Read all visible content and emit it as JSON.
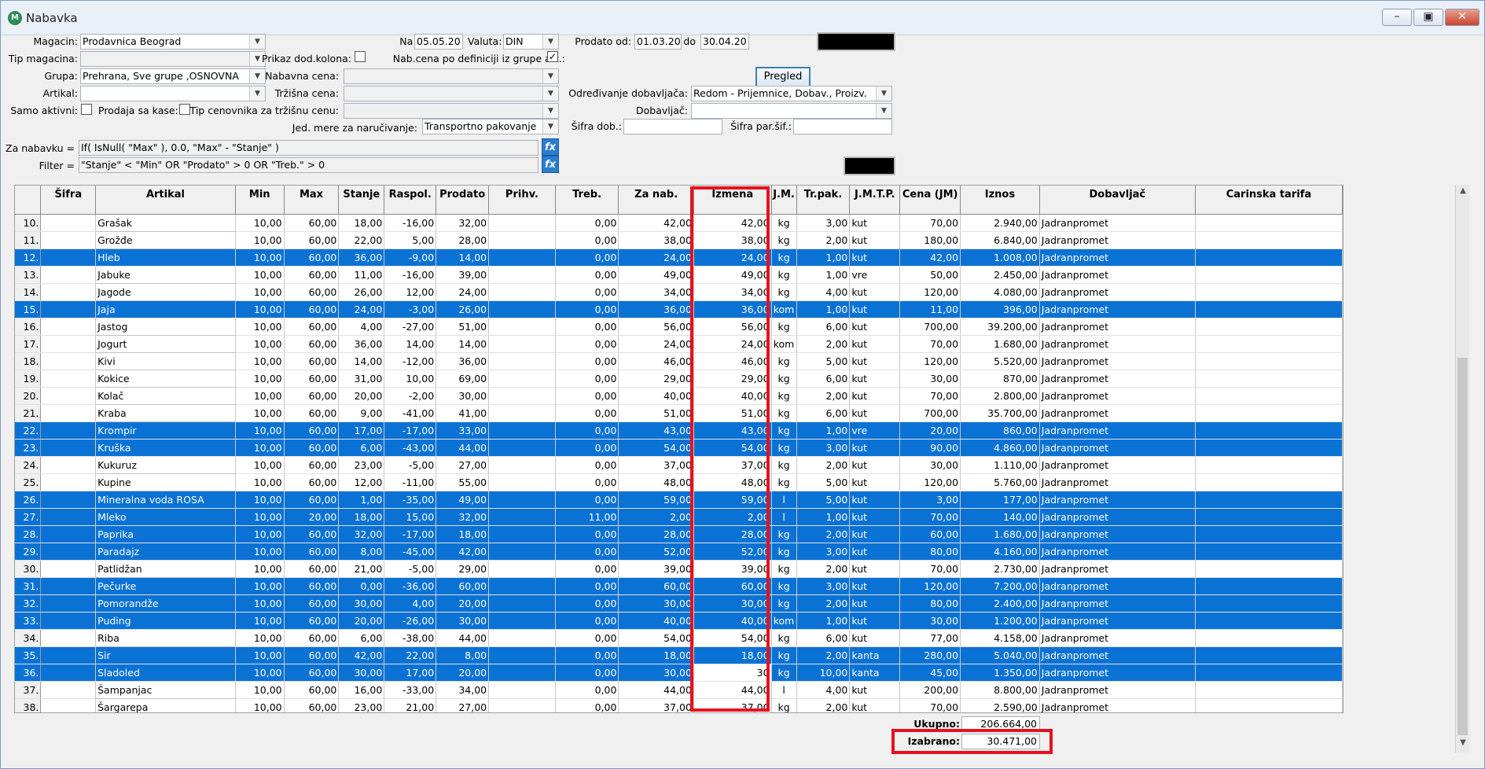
{
  "window": {
    "title": "Nabavka",
    "icon": "app-icon"
  },
  "form": {
    "magacin_label": "Magacin:",
    "magacin": "Prodavnica Beograd",
    "tip_magacina_label": "Tip magacina:",
    "tip_magacina": "",
    "grupa_label": "Grupa:",
    "grupa": "Prehrana, Sve grupe ,OSNOVNA",
    "artikal_label": "Artikal:",
    "artikal": "",
    "samo_aktivni_label": "Samo aktivni:",
    "prodaja_sa_kase_label": "Prodaja sa kase:",
    "prikaz_dod_kolona_label": "Prikaz dod.kolona:",
    "nabavna_cena_label": "Nabavna cena:",
    "trzisna_cena_label": "Tržišna cena:",
    "tip_cenovnika_label": "Tip cenovnika za tržišnu cenu:",
    "jed_mere_label": "Jed. mere za naručivanje:",
    "jed_mere": "Transportno pakovanje",
    "na_dan_label": "Na dan:",
    "na_dan": "05.05.20",
    "valuta_label": "Valuta:",
    "valuta": "DIN",
    "nab_cena_def_label": "Nab.cena po definiciji iz grupe art.:",
    "prodato_od_label": "Prodato od:",
    "prodato_od": "01.03.20",
    "do_label": "do",
    "prodato_do": "30.04.20",
    "pregled_label": "Pregled",
    "odredjivanje_label": "Određivanje dobavljača:",
    "odredjivanje": "Redom - Prijemnice, Dobav., Proizv.",
    "dobavljac_label": "Dobavljač:",
    "dobavljac": "",
    "sifra_dob_label": "Šifra dob.:",
    "sifra_par_label": "Šifra par.šif.:",
    "za_nabavku_label": "Za nabavku =",
    "za_nabavku": "If( IsNull( \"Max\" ), 0.0, \"Max\" - \"Stanje\" )",
    "filter_label": "Filter =",
    "filter": "\"Stanje\"  <  \"Min\" OR \"Prodato\" > 0 OR \"Treb.\" > 0",
    "fx_label": "fx"
  },
  "columns": [
    "",
    "Šifra",
    "Artikal",
    "Min",
    "Max",
    "Stanje",
    "Raspol.",
    "Prodato",
    "Prihv.",
    "Treb.",
    "Za nab.",
    "Izmena",
    "J.M.",
    "Tr.pak.",
    "J.M.T.P.",
    "Cena (JM)",
    "Iznos",
    "Dobavljač",
    "Carinska tarifa"
  ],
  "rows": [
    {
      "rn": "10.",
      "art": "Grašak",
      "min": "10,00",
      "max": "60,00",
      "st": "18,00",
      "ra": "-16,00",
      "pr": "32,00",
      "tr": "0,00",
      "zn": "42,00",
      "iz": "42,00",
      "jm": "kg",
      "tp": "3,00",
      "jmtp": "kut",
      "ce": "70,00",
      "izn": "2.940,00",
      "dob": "Jadranpromet",
      "sel": false
    },
    {
      "rn": "11.",
      "art": "Grožđe",
      "min": "10,00",
      "max": "60,00",
      "st": "22,00",
      "ra": "5,00",
      "pr": "28,00",
      "tr": "0,00",
      "zn": "38,00",
      "iz": "38,00",
      "jm": "kg",
      "tp": "2,00",
      "jmtp": "kut",
      "ce": "180,00",
      "izn": "6.840,00",
      "dob": "Jadranpromet",
      "sel": false
    },
    {
      "rn": "12.",
      "art": "Hleb",
      "min": "10,00",
      "max": "60,00",
      "st": "36,00",
      "ra": "-9,00",
      "pr": "14,00",
      "tr": "0,00",
      "zn": "24,00",
      "iz": "24,00",
      "jm": "kg",
      "tp": "1,00",
      "jmtp": "kut",
      "ce": "42,00",
      "izn": "1.008,00",
      "dob": "Jadranpromet",
      "sel": true
    },
    {
      "rn": "13.",
      "art": "Jabuke",
      "min": "10,00",
      "max": "60,00",
      "st": "11,00",
      "ra": "-16,00",
      "pr": "39,00",
      "tr": "0,00",
      "zn": "49,00",
      "iz": "49,00",
      "jm": "kg",
      "tp": "1,00",
      "jmtp": "vre",
      "ce": "50,00",
      "izn": "2.450,00",
      "dob": "Jadranpromet",
      "sel": false
    },
    {
      "rn": "14.",
      "art": "Jagode",
      "min": "10,00",
      "max": "60,00",
      "st": "26,00",
      "ra": "12,00",
      "pr": "24,00",
      "tr": "0,00",
      "zn": "34,00",
      "iz": "34,00",
      "jm": "kg",
      "tp": "4,00",
      "jmtp": "kut",
      "ce": "120,00",
      "izn": "4.080,00",
      "dob": "Jadranpromet",
      "sel": false
    },
    {
      "rn": "15.",
      "art": "Jaja",
      "min": "10,00",
      "max": "60,00",
      "st": "24,00",
      "ra": "-3,00",
      "pr": "26,00",
      "tr": "0,00",
      "zn": "36,00",
      "iz": "36,00",
      "jm": "kom",
      "tp": "1,00",
      "jmtp": "kut",
      "ce": "11,00",
      "izn": "396,00",
      "dob": "Jadranpromet",
      "sel": true
    },
    {
      "rn": "16.",
      "art": "Jastog",
      "min": "10,00",
      "max": "60,00",
      "st": "4,00",
      "ra": "-27,00",
      "pr": "51,00",
      "tr": "0,00",
      "zn": "56,00",
      "iz": "56,00",
      "jm": "kg",
      "tp": "6,00",
      "jmtp": "kut",
      "ce": "700,00",
      "izn": "39.200,00",
      "dob": "Jadranpromet",
      "sel": false
    },
    {
      "rn": "17.",
      "art": "Jogurt",
      "min": "10,00",
      "max": "60,00",
      "st": "36,00",
      "ra": "14,00",
      "pr": "14,00",
      "tr": "0,00",
      "zn": "24,00",
      "iz": "24,00",
      "jm": "kom",
      "tp": "2,00",
      "jmtp": "kut",
      "ce": "70,00",
      "izn": "1.680,00",
      "dob": "Jadranpromet",
      "sel": false
    },
    {
      "rn": "18.",
      "art": "Kivi",
      "min": "10,00",
      "max": "60,00",
      "st": "14,00",
      "ra": "-12,00",
      "pr": "36,00",
      "tr": "0,00",
      "zn": "46,00",
      "iz": "46,00",
      "jm": "kg",
      "tp": "5,00",
      "jmtp": "kut",
      "ce": "120,00",
      "izn": "5.520,00",
      "dob": "Jadranpromet",
      "sel": false
    },
    {
      "rn": "19.",
      "art": "Kokice",
      "min": "10,00",
      "max": "60,00",
      "st": "31,00",
      "ra": "10,00",
      "pr": "69,00",
      "tr": "0,00",
      "zn": "29,00",
      "iz": "29,00",
      "jm": "kg",
      "tp": "6,00",
      "jmtp": "kut",
      "ce": "30,00",
      "izn": "870,00",
      "dob": "Jadranpromet",
      "sel": false
    },
    {
      "rn": "20.",
      "art": "Kolač",
      "min": "10,00",
      "max": "60,00",
      "st": "20,00",
      "ra": "-2,00",
      "pr": "30,00",
      "tr": "0,00",
      "zn": "40,00",
      "iz": "40,00",
      "jm": "kg",
      "tp": "2,00",
      "jmtp": "kut",
      "ce": "70,00",
      "izn": "2.800,00",
      "dob": "Jadranpromet",
      "sel": false
    },
    {
      "rn": "21.",
      "art": "Kraba",
      "min": "10,00",
      "max": "60,00",
      "st": "9,00",
      "ra": "-41,00",
      "pr": "41,00",
      "tr": "0,00",
      "zn": "51,00",
      "iz": "51,00",
      "jm": "kg",
      "tp": "6,00",
      "jmtp": "kut",
      "ce": "700,00",
      "izn": "35.700,00",
      "dob": "Jadranpromet",
      "sel": false
    },
    {
      "rn": "22.",
      "art": "Krompir",
      "min": "10,00",
      "max": "60,00",
      "st": "17,00",
      "ra": "-17,00",
      "pr": "33,00",
      "tr": "0,00",
      "zn": "43,00",
      "iz": "43,00",
      "jm": "kg",
      "tp": "1,00",
      "jmtp": "vre",
      "ce": "20,00",
      "izn": "860,00",
      "dob": "Jadranpromet",
      "sel": true
    },
    {
      "rn": "23.",
      "art": "Kruška",
      "min": "10,00",
      "max": "60,00",
      "st": "6,00",
      "ra": "-43,00",
      "pr": "44,00",
      "tr": "0,00",
      "zn": "54,00",
      "iz": "54,00",
      "jm": "kg",
      "tp": "3,00",
      "jmtp": "kut",
      "ce": "90,00",
      "izn": "4.860,00",
      "dob": "Jadranpromet",
      "sel": true
    },
    {
      "rn": "24.",
      "art": "Kukuruz",
      "min": "10,00",
      "max": "60,00",
      "st": "23,00",
      "ra": "-5,00",
      "pr": "27,00",
      "tr": "0,00",
      "zn": "37,00",
      "iz": "37,00",
      "jm": "kg",
      "tp": "2,00",
      "jmtp": "kut",
      "ce": "30,00",
      "izn": "1.110,00",
      "dob": "Jadranpromet",
      "sel": false
    },
    {
      "rn": "25.",
      "art": "Kupine",
      "min": "10,00",
      "max": "60,00",
      "st": "12,00",
      "ra": "-11,00",
      "pr": "55,00",
      "tr": "0,00",
      "zn": "48,00",
      "iz": "48,00",
      "jm": "kg",
      "tp": "5,00",
      "jmtp": "kut",
      "ce": "120,00",
      "izn": "5.760,00",
      "dob": "Jadranpromet",
      "sel": false
    },
    {
      "rn": "26.",
      "art": "Mineralna voda ROSA",
      "min": "10,00",
      "max": "60,00",
      "st": "1,00",
      "ra": "-35,00",
      "pr": "49,00",
      "tr": "0,00",
      "zn": "59,00",
      "iz": "59,00",
      "jm": "l",
      "tp": "5,00",
      "jmtp": "kut",
      "ce": "3,00",
      "izn": "177,00",
      "dob": "Jadranpromet",
      "sel": true
    },
    {
      "rn": "27.",
      "art": "Mleko",
      "min": "10,00",
      "max": "20,00",
      "st": "18,00",
      "ra": "15,00",
      "pr": "32,00",
      "tr": "11,00",
      "zn": "2,00",
      "iz": "2,00",
      "jm": "l",
      "tp": "1,00",
      "jmtp": "kut",
      "ce": "70,00",
      "izn": "140,00",
      "dob": "Jadranpromet",
      "sel": true
    },
    {
      "rn": "28.",
      "art": "Paprika",
      "min": "10,00",
      "max": "60,00",
      "st": "32,00",
      "ra": "-17,00",
      "pr": "18,00",
      "tr": "0,00",
      "zn": "28,00",
      "iz": "28,00",
      "jm": "kg",
      "tp": "2,00",
      "jmtp": "kut",
      "ce": "60,00",
      "izn": "1.680,00",
      "dob": "Jadranpromet",
      "sel": true
    },
    {
      "rn": "29.",
      "art": "Paradajz",
      "min": "10,00",
      "max": "60,00",
      "st": "8,00",
      "ra": "-45,00",
      "pr": "42,00",
      "tr": "0,00",
      "zn": "52,00",
      "iz": "52,00",
      "jm": "kg",
      "tp": "3,00",
      "jmtp": "kut",
      "ce": "80,00",
      "izn": "4.160,00",
      "dob": "Jadranpromet",
      "sel": true
    },
    {
      "rn": "30.",
      "art": "Patlidžan",
      "min": "10,00",
      "max": "60,00",
      "st": "21,00",
      "ra": "-5,00",
      "pr": "29,00",
      "tr": "0,00",
      "zn": "39,00",
      "iz": "39,00",
      "jm": "kg",
      "tp": "2,00",
      "jmtp": "kut",
      "ce": "70,00",
      "izn": "2.730,00",
      "dob": "Jadranpromet",
      "sel": false
    },
    {
      "rn": "31.",
      "art": "Pečurke",
      "min": "10,00",
      "max": "60,00",
      "st": "0,00",
      "ra": "-36,00",
      "pr": "60,00",
      "tr": "0,00",
      "zn": "60,00",
      "iz": "60,00",
      "jm": "kg",
      "tp": "3,00",
      "jmtp": "kut",
      "ce": "120,00",
      "izn": "7.200,00",
      "dob": "Jadranpromet",
      "sel": true
    },
    {
      "rn": "32.",
      "art": "Pomorandže",
      "min": "10,00",
      "max": "60,00",
      "st": "30,00",
      "ra": "4,00",
      "pr": "20,00",
      "tr": "0,00",
      "zn": "30,00",
      "iz": "30,00",
      "jm": "kg",
      "tp": "2,00",
      "jmtp": "kut",
      "ce": "80,00",
      "izn": "2.400,00",
      "dob": "Jadranpromet",
      "sel": true
    },
    {
      "rn": "33.",
      "art": "Puding",
      "min": "10,00",
      "max": "60,00",
      "st": "20,00",
      "ra": "-26,00",
      "pr": "30,00",
      "tr": "0,00",
      "zn": "40,00",
      "iz": "40,00",
      "jm": "kom",
      "tp": "1,00",
      "jmtp": "kut",
      "ce": "30,00",
      "izn": "1.200,00",
      "dob": "Jadranpromet",
      "sel": true
    },
    {
      "rn": "34.",
      "art": "Riba",
      "min": "10,00",
      "max": "60,00",
      "st": "6,00",
      "ra": "-38,00",
      "pr": "44,00",
      "tr": "0,00",
      "zn": "54,00",
      "iz": "54,00",
      "jm": "kg",
      "tp": "6,00",
      "jmtp": "kut",
      "ce": "77,00",
      "izn": "4.158,00",
      "dob": "Jadranpromet",
      "sel": false
    },
    {
      "rn": "35.",
      "art": "Sir",
      "min": "10,00",
      "max": "60,00",
      "st": "42,00",
      "ra": "22,00",
      "pr": "8,00",
      "tr": "0,00",
      "zn": "18,00",
      "iz": "18,00",
      "jm": "kg",
      "tp": "2,00",
      "jmtp": "kanta",
      "ce": "280,00",
      "izn": "5.040,00",
      "dob": "Jadranpromet",
      "sel": true
    },
    {
      "rn": "36.",
      "art": "Sladoled",
      "min": "10,00",
      "max": "60,00",
      "st": "30,00",
      "ra": "17,00",
      "pr": "20,00",
      "tr": "0,00",
      "zn": "30,00",
      "iz": "30",
      "jm": "kg",
      "tp": "10,00",
      "jmtp": "kanta",
      "ce": "45,00",
      "izn": "1.350,00",
      "dob": "Jadranpromet",
      "sel": true,
      "editing": true
    },
    {
      "rn": "37.",
      "art": "Šampanjac",
      "min": "10,00",
      "max": "60,00",
      "st": "16,00",
      "ra": "-33,00",
      "pr": "34,00",
      "tr": "0,00",
      "zn": "44,00",
      "iz": "44,00",
      "jm": "l",
      "tp": "4,00",
      "jmtp": "kut",
      "ce": "200,00",
      "izn": "8.800,00",
      "dob": "Jadranpromet",
      "sel": false
    },
    {
      "rn": "38.",
      "art": "Šargarepa",
      "min": "10,00",
      "max": "60,00",
      "st": "23,00",
      "ra": "21,00",
      "pr": "27,00",
      "tr": "0,00",
      "zn": "37,00",
      "iz": "37,00",
      "jm": "kg",
      "tp": "2,00",
      "jmtp": "kut",
      "ce": "70,00",
      "izn": "2.590,00",
      "dob": "Jadranpromet",
      "sel": false
    }
  ],
  "footer": {
    "ukupno_label": "Ukupno:",
    "ukupno": "206.664,00",
    "izabrano_label": "Izabrano:",
    "izabrano": "30.471,00"
  },
  "colors": {
    "selection": "#0a72d4",
    "highlight": "#e8101e"
  }
}
